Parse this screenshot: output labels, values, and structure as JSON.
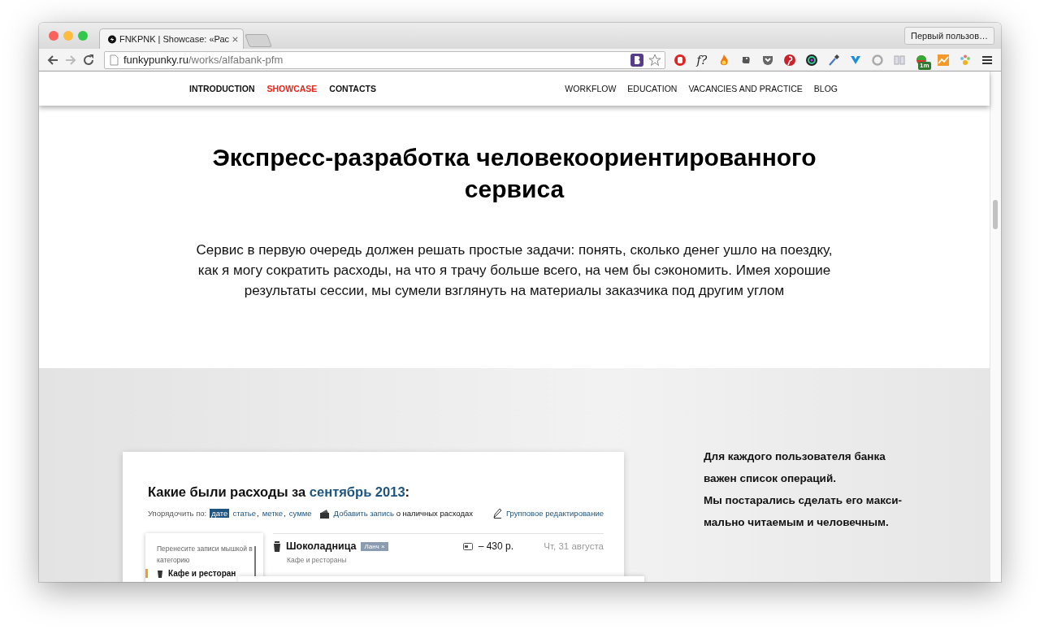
{
  "browser": {
    "tab": {
      "title": "FNKPNK | Showcase: «Рас",
      "selected": true
    },
    "profile_button": "Первый пользов…",
    "forward": {
      "disabled": true
    },
    "url": {
      "host": "funkypunky.ru",
      "path": "/works/alfabank-pfm"
    },
    "extension_label": "f?",
    "extension_badge": "1m"
  },
  "nav": {
    "left": [
      {
        "label": "INTRODUCTION",
        "selected": false
      },
      {
        "label": "SHOWCASE",
        "selected": true
      },
      {
        "label": "CONTACTS",
        "selected": false
      }
    ],
    "right": [
      {
        "label": "WORKFLOW"
      },
      {
        "label": "EDUCATION"
      },
      {
        "label": "VACANCIES AND PRACTICE"
      },
      {
        "label": "BLOG"
      }
    ]
  },
  "heading": "Экспресс-разработка человекоориентированного сервиса",
  "intro": "Сервис в первую очередь должен решать простые задачи: понять, сколько денег ушло на поездку, как я могу сократить расходы, на что я трачу больше всего, на чем бы сэкономить. Имея хорошие результаты сессии, мы сумели взглянуть на материалы заказчика под другим углом",
  "app_preview": {
    "title": {
      "text": "Какие были расходы за ",
      "link": "сентябрь 2013",
      "suffix": ":"
    },
    "sort": {
      "label": "Упорядочить по:",
      "options": [
        {
          "label": "дате",
          "selected": true
        },
        {
          "label": "статье",
          "selected": false,
          "separator": ","
        },
        {
          "label": "метке",
          "selected": false,
          "separator": ","
        },
        {
          "label": "сумме",
          "selected": false
        }
      ]
    },
    "add_action": {
      "link": "Добавить запись",
      "text": " о наличных расходах"
    },
    "group_edit": "Групповое редактирование",
    "side_panel": {
      "hint": "Перенесите записи мышкой в категорию",
      "category": "Кафе и ресторан"
    },
    "transaction": {
      "name": "Шоколадница",
      "tag": "Ланч ×",
      "category": "Кафе и рестораны",
      "amount": "– 430 р.",
      "date": "Чт, 31 августа"
    }
  },
  "side_note": {
    "lines": [
      "Для каждого пользователя банка",
      "важен список операций.",
      "Мы постарались сделать его макси-",
      "мально читаемым и человечным."
    ]
  }
}
